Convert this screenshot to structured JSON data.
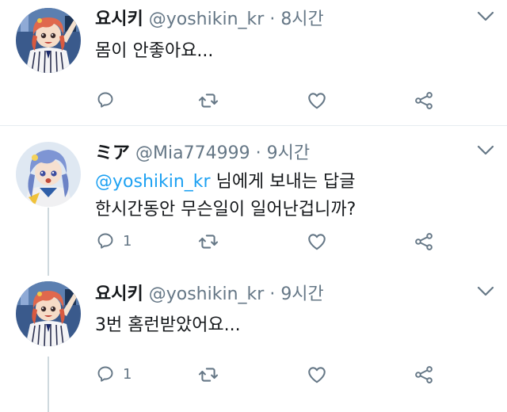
{
  "tweets": [
    {
      "name": "요시키",
      "handle": "@yoshikin_kr",
      "time": "8시간",
      "text": "몸이 안좋아요...",
      "reply_count": ""
    },
    {
      "name": "ミア",
      "handle": "@Mia774999",
      "time": "9시간",
      "reply_to_handle": "@yoshikin_kr",
      "reply_to_suffix": "님에게 보내는 답글",
      "text": "한시간동안 무슨일이 일어난겁니까?",
      "reply_count": "1"
    },
    {
      "name": "요시키",
      "handle": "@yoshikin_kr",
      "time": "9시간",
      "text": "3번 홈런받았어요...",
      "reply_count": "1"
    }
  ],
  "separator": "·",
  "icons": [
    "reply-icon",
    "retweet-icon",
    "like-icon",
    "share-icon",
    "chevron-down-icon"
  ],
  "colors": {
    "link": "#1da1f2",
    "muted": "#657786",
    "icon": "#657786",
    "divider": "#e6ecf0"
  }
}
